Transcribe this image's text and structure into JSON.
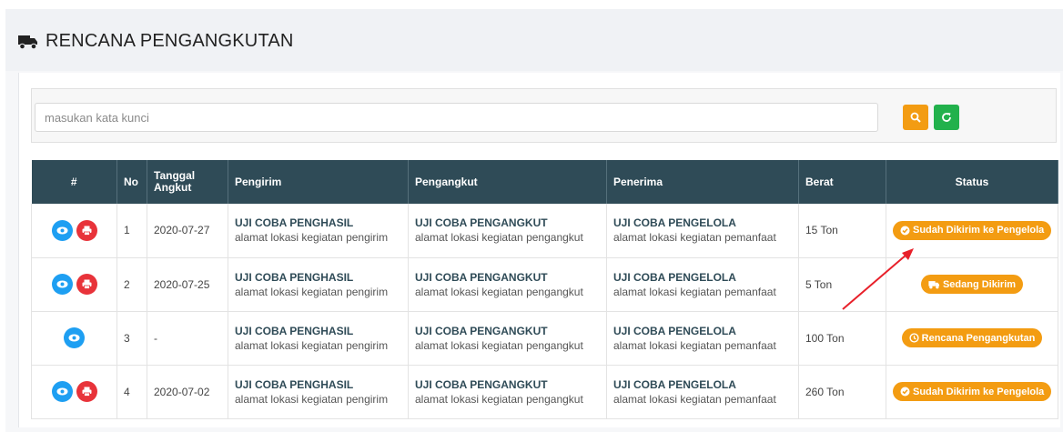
{
  "page": {
    "title": "RENCANA PENGANGKUTAN",
    "title_icon": "truck-icon"
  },
  "search": {
    "placeholder": "masukan kata kunci",
    "value": "",
    "search_icon": "search-icon",
    "refresh_icon": "refresh-icon"
  },
  "colors": {
    "header_bg": "#2f4b57",
    "badge": "#f39c12",
    "view": "#1e9ff2",
    "print": "#e8333a",
    "refresh": "#22b14c",
    "annotation_arrow": "#e8202a"
  },
  "table": {
    "headers": {
      "actions": "#",
      "no": "No",
      "tanggal": "Tanggal Angkut",
      "pengirim": "Pengirim",
      "pengangkut": "Pengangkut",
      "penerima": "Penerima",
      "berat": "Berat",
      "status": "Status"
    },
    "rows": [
      {
        "no": "1",
        "tanggal": "2020-07-27",
        "pengirim_name": "UJI COBA PENGHASIL",
        "pengirim_addr": "alamat lokasi kegiatan pengirim",
        "pengangkut_name": "UJI COBA PENGANGKUT",
        "pengangkut_addr": "alamat lokasi kegiatan pengangkut",
        "penerima_name": "UJI COBA PENGELOLA",
        "penerima_addr": "alamat lokasi kegiatan pemanfaat",
        "berat": "15 Ton",
        "status": "Sudah Dikirim ke Pengelola",
        "status_icon": "check-circle-icon",
        "has_print": true
      },
      {
        "no": "2",
        "tanggal": "2020-07-25",
        "pengirim_name": "UJI COBA PENGHASIL",
        "pengirim_addr": "alamat lokasi kegiatan pengirim",
        "pengangkut_name": "UJI COBA PENGANGKUT",
        "pengangkut_addr": "alamat lokasi kegiatan pengangkut",
        "penerima_name": "UJI COBA PENGELOLA",
        "penerima_addr": "alamat lokasi kegiatan pemanfaat",
        "berat": "5 Ton",
        "status": "Sedang Dikirim",
        "status_icon": "truck-icon",
        "has_print": true
      },
      {
        "no": "3",
        "tanggal": "-",
        "pengirim_name": "UJI COBA PENGHASIL",
        "pengirim_addr": "alamat lokasi kegiatan pengirim",
        "pengangkut_name": "UJI COBA PENGANGKUT",
        "pengangkut_addr": "alamat lokasi kegiatan pengangkut",
        "penerima_name": "UJI COBA PENGELOLA",
        "penerima_addr": "alamat lokasi kegiatan pemanfaat",
        "berat": "100 Ton",
        "status": "Rencana Pengangkutan",
        "status_icon": "clock-icon",
        "has_print": false
      },
      {
        "no": "4",
        "tanggal": "2020-07-02",
        "pengirim_name": "UJI COBA PENGHASIL",
        "pengirim_addr": "alamat lokasi kegiatan pengirim",
        "pengangkut_name": "UJI COBA PENGANGKUT",
        "pengangkut_addr": "alamat lokasi kegiatan pengangkut",
        "penerima_name": "UJI COBA PENGELOLA",
        "penerima_addr": "alamat lokasi kegiatan pemanfaat",
        "berat": "260 Ton",
        "status": "Sudah Dikirim ke Pengelola",
        "status_icon": "check-circle-icon",
        "has_print": true
      }
    ]
  }
}
